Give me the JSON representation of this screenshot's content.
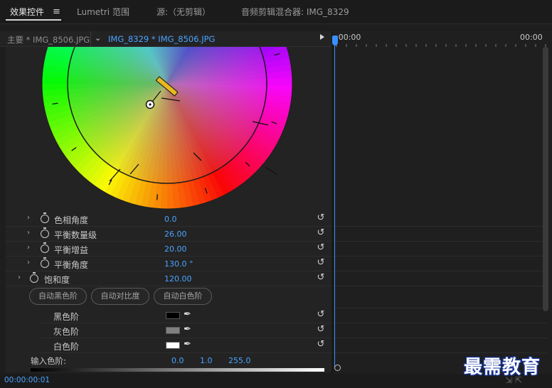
{
  "tabs": [
    {
      "label": "效果控件",
      "active": true
    },
    {
      "label": "Lumetri 范围",
      "active": false
    },
    {
      "label": "源:（无剪辑）",
      "active": false
    },
    {
      "label": "音频剪辑混合器: IMG_8329",
      "active": false
    }
  ],
  "menu_icon": "hamburger-menu-icon",
  "clip_bar": {
    "master": "主要 * IMG_8506.JPG",
    "sequence": "IMG_8329 * IMG_8506.JPG"
  },
  "timeline": {
    "start_time": ":00:00",
    "end_time": "00:00"
  },
  "properties": [
    {
      "name": "色相角度",
      "value": "0.0",
      "indent": 1
    },
    {
      "name": "平衡数量级",
      "value": "26.00",
      "indent": 1
    },
    {
      "name": "平衡增益",
      "value": "20.00",
      "indent": 1
    },
    {
      "name": "平衡角度",
      "value": "130.0 °",
      "indent": 1
    },
    {
      "name": "饱和度",
      "value": "120.00",
      "indent": 0
    }
  ],
  "buttons": {
    "auto_black": "自动黑色阶",
    "auto_contrast": "自动对比度",
    "auto_white": "自动白色阶"
  },
  "levels": [
    {
      "name": "黑色阶",
      "color": "#000000"
    },
    {
      "name": "灰色阶",
      "color": "#808080"
    },
    {
      "name": "白色阶",
      "color": "#ffffff"
    }
  ],
  "input_levels": {
    "label": "输入色阶:",
    "black": "0.0",
    "gamma": "1.0",
    "white": "255.0"
  },
  "status": {
    "timecode": "00:00:00:01"
  },
  "watermark": "最需教育",
  "colors": {
    "accent": "#4aa3ff",
    "playhead": "#3a8fff",
    "balance_handle": "#e8b820"
  }
}
